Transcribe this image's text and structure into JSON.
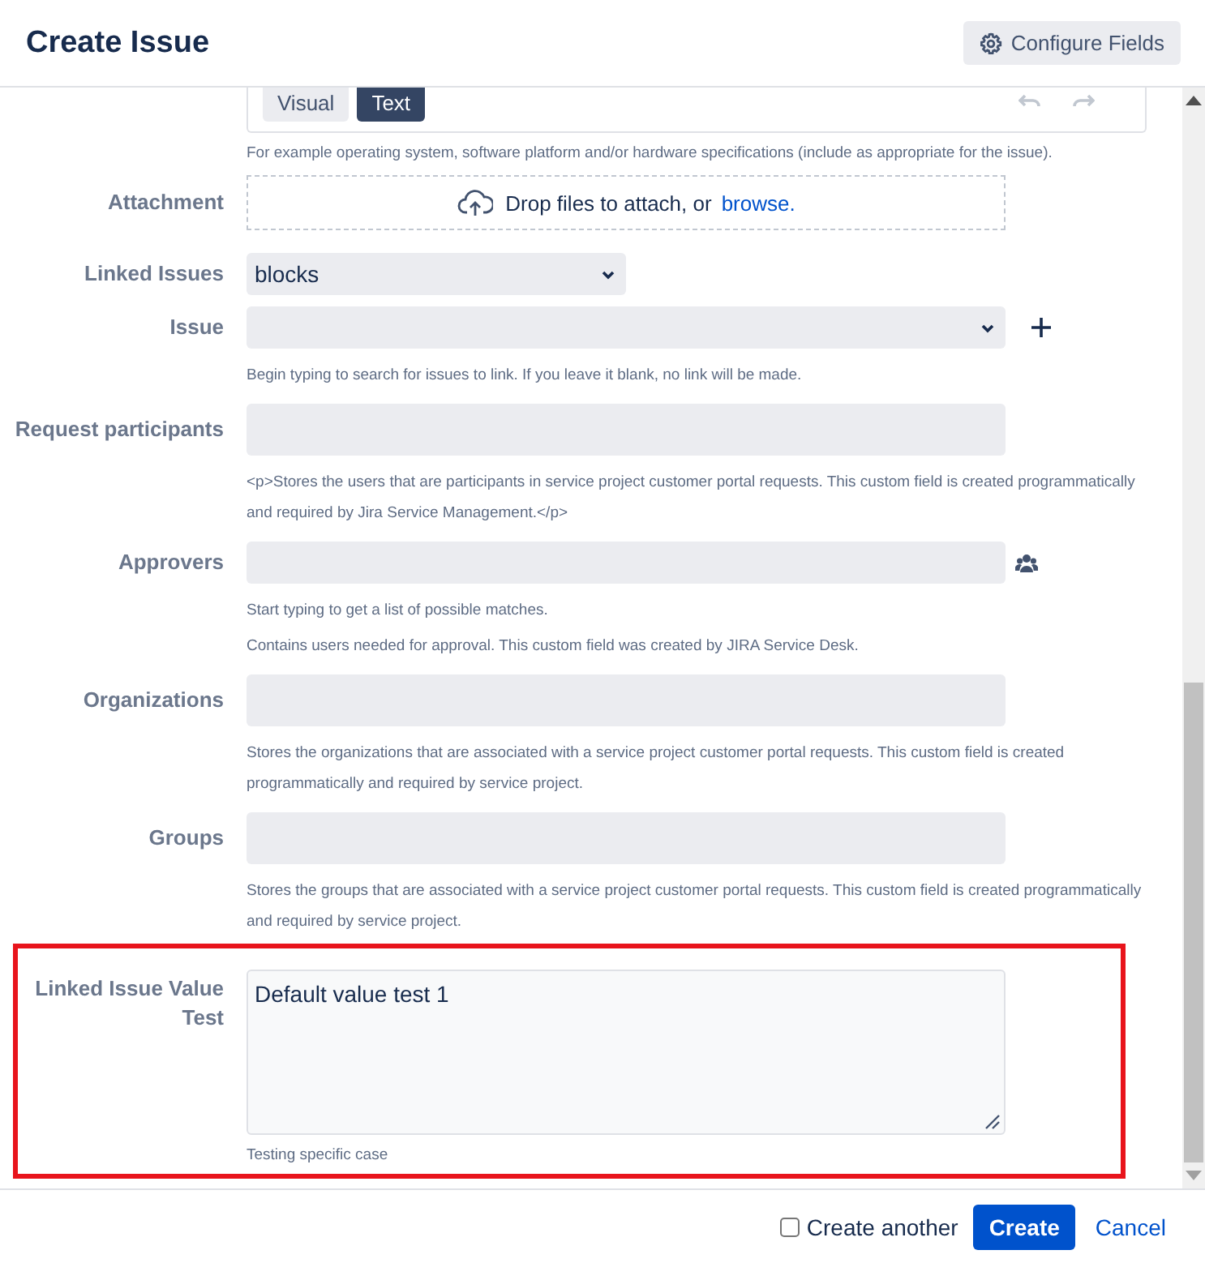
{
  "dialog": {
    "title": "Create Issue",
    "configure_button": "Configure Fields"
  },
  "editor": {
    "tabs": [
      {
        "label": "Visual",
        "selected": false
      },
      {
        "label": "Text",
        "selected": true
      }
    ],
    "description": "For example operating system, software platform and/or hardware specifications (include as appropriate for the issue)."
  },
  "attachment": {
    "label": "Attachment",
    "prompt": "Drop files to attach, or",
    "link": "browse."
  },
  "fields": [
    {
      "kind": "select",
      "label": "Linked Issues",
      "value": "blocks",
      "highlighted": false
    },
    {
      "kind": "issue-picker",
      "label": "Issue",
      "help": [
        "Begin typing to search for issues to link. If you leave it blank, no link will be made."
      ],
      "highlighted": false
    },
    {
      "kind": "text",
      "label": "Request participants",
      "help": [
        "<p>Stores the users that are participants in service project customer portal requests. This custom field is created programmatically and required by Jira Service Management.</p>"
      ],
      "highlighted": false
    },
    {
      "kind": "user-picker",
      "label": "Approvers",
      "help": [
        "Start typing to get a list of possible matches.",
        "Contains users needed for approval. This custom field was created by JIRA Service Desk."
      ],
      "highlighted": false
    },
    {
      "kind": "text",
      "label": "Organizations",
      "help": [
        "Stores the organizations that are associated with a service project customer portal requests. This custom field is created programmatically and required by service project."
      ],
      "highlighted": false
    },
    {
      "kind": "text",
      "label": "Groups",
      "help": [
        "Stores the groups that are associated with a service project customer portal requests. This custom field is created programmatically and required by service project."
      ],
      "highlighted": false
    },
    {
      "kind": "textarea",
      "label": "Linked Issue Value Test",
      "value": "Default value test 1",
      "help": [
        "Testing specific case"
      ],
      "highlighted": true
    }
  ],
  "footer": {
    "create_another": {
      "label": "Create another",
      "checked": false
    },
    "create_button": "Create",
    "cancel_link": "Cancel"
  }
}
